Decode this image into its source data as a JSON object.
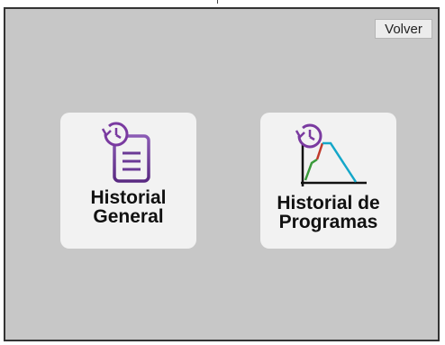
{
  "toolbar": {
    "back_label": "Volver"
  },
  "tiles": [
    {
      "line1": "Historial",
      "line2": "General",
      "icon": "document-history-icon"
    },
    {
      "line1": "Historial de",
      "line2": "Programas",
      "icon": "program-chart-history-icon"
    }
  ],
  "colors": {
    "screen_background": "#c7c7c7",
    "tile_background": "#f2f2f2",
    "icon_purple": "#7a3aa0",
    "chart_green": "#3a9a3a",
    "chart_red": "#c0392b",
    "chart_cyan": "#14a7c9"
  }
}
